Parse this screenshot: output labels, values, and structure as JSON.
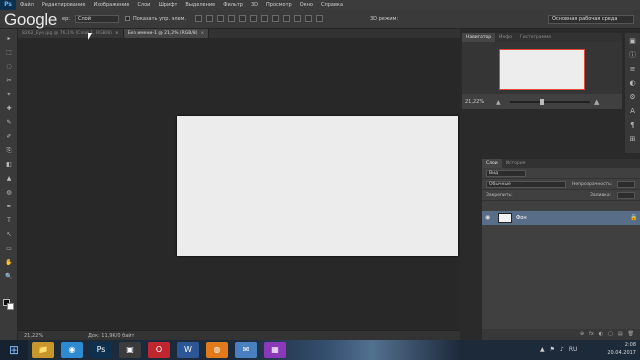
{
  "watermark": "Google",
  "menubar": {
    "logo": "Ps",
    "items": [
      "Файл",
      "Редактирование",
      "Изображение",
      "Слои",
      "Шрифт",
      "Выделение",
      "Фильтр",
      "3D",
      "Просмотр",
      "Окно",
      "Справка"
    ]
  },
  "options": {
    "sample_label": "ер:",
    "sample_value": "Слой",
    "checkbox_label": "Показать упр. элем.",
    "mode_3d": "3D режим:",
    "workspace": "Основная рабочая среда"
  },
  "doc_tabs": [
    {
      "label": "8262_Eye.jpg @ 76,1% (Слой 1, RGB/8)",
      "close": "×",
      "active": false
    },
    {
      "label": "Без имени-1 @ 21,2% (RGB/8)",
      "close": "×",
      "active": true
    }
  ],
  "status": {
    "zoom": "21,22%",
    "doc": "Док: 11,9K/0 байт"
  },
  "navigator": {
    "tabs": [
      "Навигатор",
      "Инфо",
      "Гистограмма"
    ],
    "zoom": "21,22%",
    "slider_value": 0.4
  },
  "layers": {
    "tabs": [
      "Слои",
      "История"
    ],
    "filter_label": "Вид",
    "blend_mode": "Обычные",
    "opacity_label": "Непрозрачность:",
    "lock_label": "Закрепить:",
    "fill_label": "Заливка:",
    "layer_name": "Фон",
    "bottom_icons": [
      "⊕",
      "fx",
      "◐",
      "▢",
      "▤",
      "🗑"
    ]
  },
  "tools": [
    "▸",
    "⬚",
    "◌",
    "✂",
    "⌖",
    "✚",
    "✎",
    "✐",
    "⎘",
    "◧",
    "▲",
    "◍",
    "✒",
    "T",
    "↖",
    "▭",
    "✋",
    "🔍"
  ],
  "right_strip_icons": [
    "▣",
    "ⓘ",
    "≡",
    "◐",
    "⚙",
    "A",
    "¶",
    "⊞"
  ],
  "taskbar": {
    "start": "⊞",
    "apps": [
      {
        "glyph": "📁",
        "color": "#c9962b"
      },
      {
        "glyph": "◉",
        "color": "#2f8bd1"
      },
      {
        "glyph": "Ps",
        "color": "#0f2f4f"
      },
      {
        "glyph": "▣",
        "color": "#3b3b3b"
      },
      {
        "glyph": "O",
        "color": "#c0262d"
      },
      {
        "glyph": "W",
        "color": "#2b5797"
      },
      {
        "glyph": "◍",
        "color": "#e07a1a"
      },
      {
        "glyph": "✉",
        "color": "#4a7fc0"
      },
      {
        "glyph": "▦",
        "color": "#8a3ab9"
      }
    ],
    "time": "2:08",
    "date": "20.04.2017",
    "tray": [
      "▲",
      "⚑",
      "♪",
      "RU"
    ]
  }
}
